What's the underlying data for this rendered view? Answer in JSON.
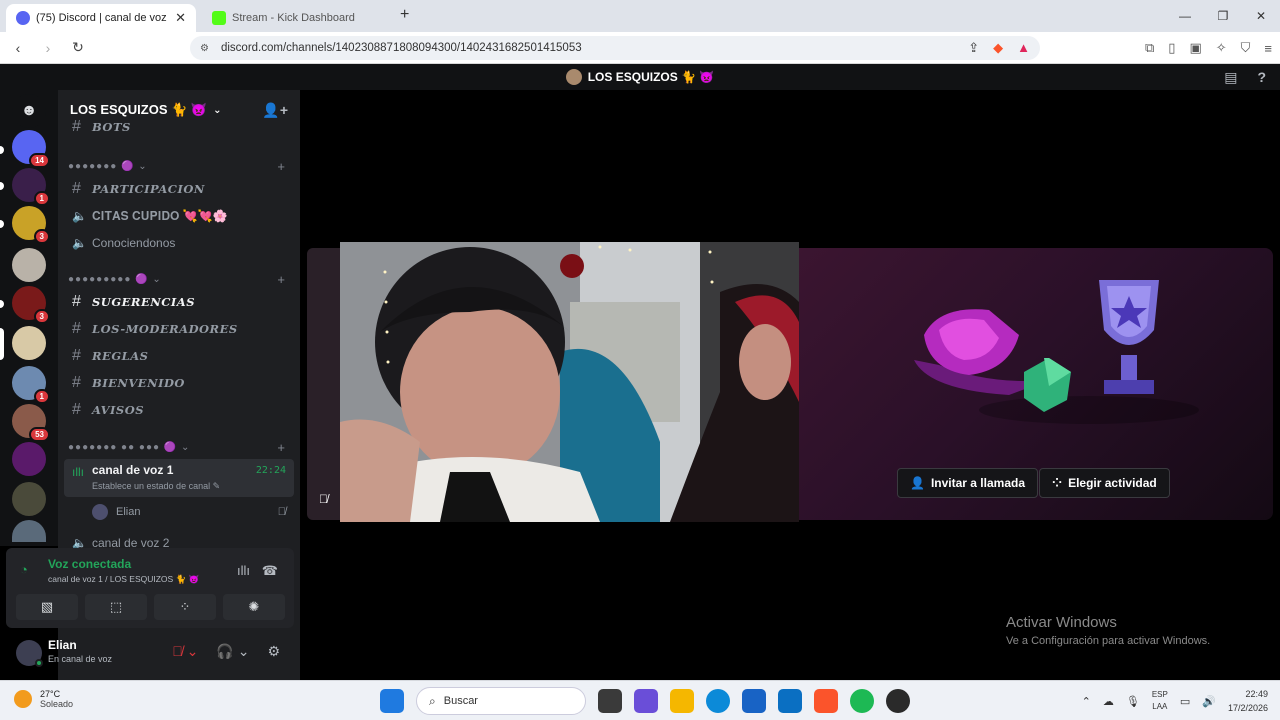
{
  "browser": {
    "tabs": [
      {
        "title": "(75) Discord | canal de voz 1 |",
        "active": true
      },
      {
        "title": "Stream - Kick Dashboard",
        "active": false
      }
    ],
    "url": "discord.com/channels/1402308871808094300/1402431682501415053"
  },
  "discord": {
    "server_name": "LOS ESQUIZOS 🐈 👿",
    "guild_badges": [
      "14",
      "1",
      "3",
      "3",
      "1",
      "53"
    ],
    "channels": {
      "bots": "BOTS",
      "participacion": "PARTICIPACION",
      "citas": "𝐂𝐈𝐓𝐀𝐒 𝐂𝐔𝐏𝐈𝐃𝐎 💘💘🌸",
      "conociendonos": "Conociendonos",
      "sugerencias": "SUGERENCIAS",
      "moderadores": "LOS-MODERADORES",
      "reglas": "REGLAS",
      "bienvenido": "BIENVENIDO",
      "avisos": "AVISOS",
      "voice1": "canal de voz 1",
      "voice1_status": "Establece un estado de canal ✎",
      "voice1_time": "22:24",
      "voice1_member": "Elian",
      "voice2": "canal de voz 2"
    },
    "categories": [
      "●●●●●●● 🟣 ⌄",
      "●●●●●●●●● 🟣 ⌄",
      "●●●●●●● ●● ●●● 🟣 ⌄"
    ],
    "voice_panel": {
      "title": "Voz conectada",
      "subtitle": "canal de voz 1 / LOS ESQUIZOS 🐈 👿"
    },
    "user": {
      "name": "Elian",
      "status": "En canal de voz"
    },
    "activity": {
      "invite": "Invitar a llamada",
      "choose": "Elegir actividad"
    }
  },
  "windows": {
    "watermark_title": "Activar Windows",
    "watermark_sub": "Ve a Configuración para activar Windows."
  },
  "taskbar": {
    "temp": "27°C",
    "weather": "Soleado",
    "search": "Buscar",
    "lang1": "ESP",
    "lang2": "LAA",
    "time": "22:49",
    "date": "17/2/2026"
  }
}
